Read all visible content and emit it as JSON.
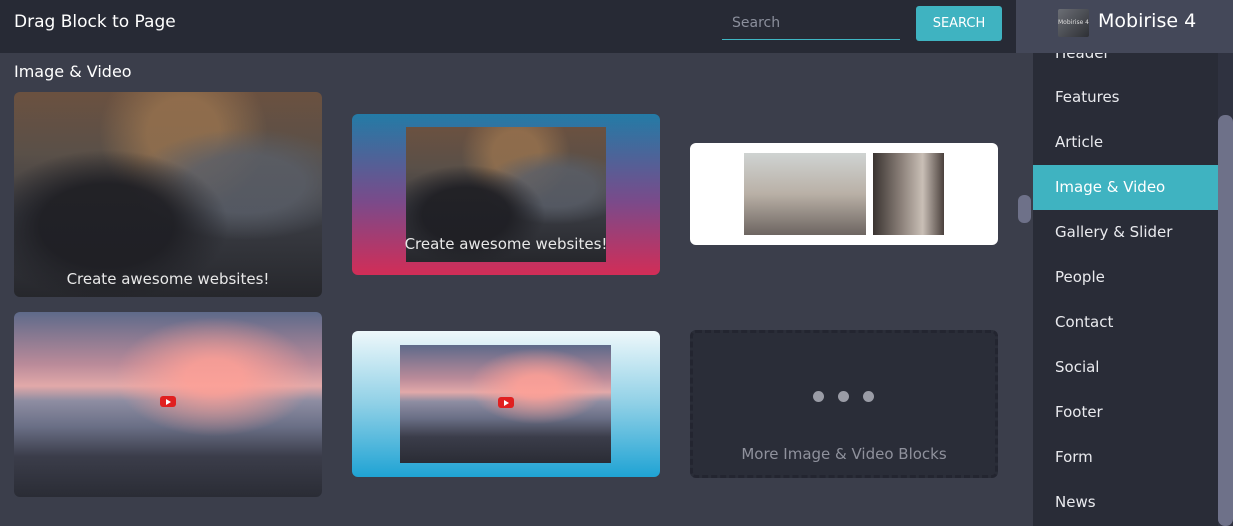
{
  "header": {
    "title": "Drag Block to Page",
    "search_placeholder": "Search",
    "search_value": "",
    "search_button": "SEARCH"
  },
  "brand": {
    "logo_text": "Mobirise 4",
    "name": "Mobirise 4"
  },
  "sidebar": {
    "items": [
      {
        "label": "Header"
      },
      {
        "label": "Features"
      },
      {
        "label": "Article"
      },
      {
        "label": "Image & Video"
      },
      {
        "label": "Gallery & Slider"
      },
      {
        "label": "People"
      },
      {
        "label": "Contact"
      },
      {
        "label": "Social"
      },
      {
        "label": "Footer"
      },
      {
        "label": "Form"
      },
      {
        "label": "News"
      }
    ],
    "active": "Image & Video"
  },
  "content": {
    "section_title": "Image & Video",
    "cards": [
      {
        "overlay_text": "Create awesome websites!"
      },
      {
        "overlay_text": "Create awesome websites!"
      },
      {
        "overlay_text": ""
      },
      {
        "overlay_text": ""
      },
      {
        "overlay_text": ""
      }
    ],
    "more_label": "More Image & Video Blocks"
  },
  "colors": {
    "accent": "#3fb3c1",
    "topbar": "#272a35",
    "background": "#3b3e4b"
  }
}
